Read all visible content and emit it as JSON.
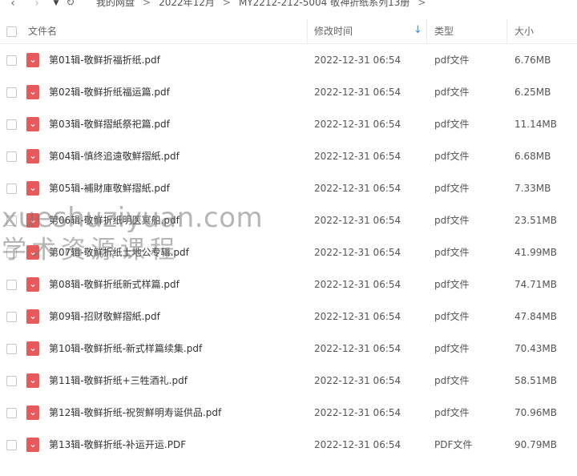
{
  "nav": {
    "back_icon": "‹",
    "forward_icon": "›",
    "dropdown_icon": "▼",
    "refresh_icon": "↻"
  },
  "breadcrumb": {
    "items": [
      "我的网盘",
      "2022年12月",
      "MY2212-212-5004 敬神折纸系列13册"
    ],
    "separator": ">"
  },
  "columns": {
    "name": "文件名",
    "modified": "修改时间",
    "type": "类型",
    "size": "大小",
    "sort_icon": "↓"
  },
  "files": [
    {
      "name": "第01辑-敬鲜折福折纸.pdf",
      "modified": "2022-12-31 06:54",
      "type": "pdf文件",
      "size": "6.76MB"
    },
    {
      "name": "第02辑-敬鲜折纸福运篇.pdf",
      "modified": "2022-12-31 06:54",
      "type": "pdf文件",
      "size": "6.25MB"
    },
    {
      "name": "第03辑-敬鲜摺紙祭祀篇.pdf",
      "modified": "2022-12-31 06:54",
      "type": "pdf文件",
      "size": "11.14MB"
    },
    {
      "name": "第04辑-慎终追遠敬鮮摺紙.pdf",
      "modified": "2022-12-31 06:54",
      "type": "pdf文件",
      "size": "6.68MB"
    },
    {
      "name": "第05辑-補財庫敬鮮摺紙.pdf",
      "modified": "2022-12-31 06:54",
      "type": "pdf文件",
      "size": "7.33MB"
    },
    {
      "name": "第06辑-敬鲜折纸明医冥船.pdf",
      "modified": "2022-12-31 06:54",
      "type": "pdf文件",
      "size": "23.51MB"
    },
    {
      "name": "第07辑-敬鲜折纸土地公专辑.pdf",
      "modified": "2022-12-31 06:54",
      "type": "pdf文件",
      "size": "41.99MB"
    },
    {
      "name": "第08辑-敬鲜折纸新式样篇.pdf",
      "modified": "2022-12-31 06:54",
      "type": "pdf文件",
      "size": "74.71MB"
    },
    {
      "name": "第09辑-招财敬鮮摺紙.pdf",
      "modified": "2022-12-31 06:54",
      "type": "pdf文件",
      "size": "47.84MB"
    },
    {
      "name": "第10辑-敬鲜折纸-新式样篇续集.pdf",
      "modified": "2022-12-31 06:54",
      "type": "pdf文件",
      "size": "70.43MB"
    },
    {
      "name": "第11辑-敬鲜折纸+三牲酒礼.pdf",
      "modified": "2022-12-31 06:54",
      "type": "pdf文件",
      "size": "58.51MB"
    },
    {
      "name": "第12辑-敬鲜折纸-祝贺鮮明寿诞供品.pdf",
      "modified": "2022-12-31 06:54",
      "type": "pdf文件",
      "size": "70.96MB"
    },
    {
      "name": "第13辑-敬鲜折纸-补运开运.PDF",
      "modified": "2022-12-31 06:54",
      "type": "PDF文件",
      "size": "90.79MB"
    }
  ],
  "watermark": {
    "line1": "xueshuziyuan.com",
    "line2": "学术资源课程"
  }
}
